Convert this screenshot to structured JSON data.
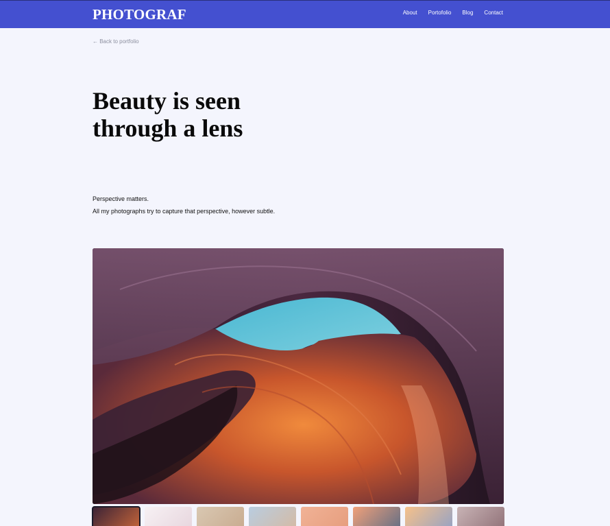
{
  "nav": {
    "brand": "PHOTOGRAF",
    "links": [
      "About",
      "Portofolio",
      "Blog",
      "Contact"
    ]
  },
  "back_link": "← Back to portfolio",
  "title_lines": [
    "Beauty is seen",
    "through a lens"
  ],
  "lead": {
    "line1": "Perspective matters.",
    "line2": "All my photographs try to capture that perspective, however subtle."
  },
  "hero": {
    "icon": "canyon-photo"
  },
  "thumbnails": [
    {
      "icon": "canyon-thumb",
      "active": true,
      "colors": [
        "#3a2236",
        "#d06a3a"
      ]
    },
    {
      "icon": "silk-thumb",
      "active": false,
      "colors": [
        "#f7f1f4",
        "#e6d4dc"
      ]
    },
    {
      "icon": "dunes-thumb",
      "active": false,
      "colors": [
        "#d9c8b2",
        "#c7a98d"
      ]
    },
    {
      "icon": "desert-thumb",
      "active": false,
      "colors": [
        "#b9cde0",
        "#d6b9a0"
      ]
    },
    {
      "icon": "arch-thumb",
      "active": false,
      "colors": [
        "#f1b296",
        "#e59c7c"
      ]
    },
    {
      "icon": "ring-thumb",
      "active": false,
      "colors": [
        "#f0a07a",
        "#5a6b85"
      ]
    },
    {
      "icon": "sunset-thumb",
      "active": false,
      "colors": [
        "#f6c18a",
        "#8fa0c8"
      ]
    },
    {
      "icon": "rock-thumb",
      "active": false,
      "colors": [
        "#c8b3b5",
        "#8d6d74"
      ]
    }
  ],
  "colors": {
    "nav_bg": "#4450d0",
    "page_bg": "#f4f5fd",
    "sky": "#5ec3d9"
  }
}
